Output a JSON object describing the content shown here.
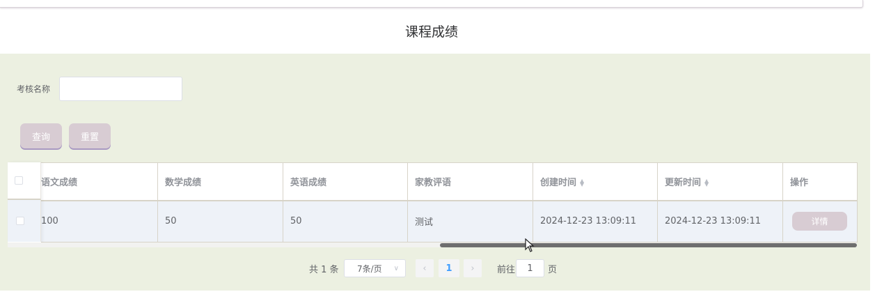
{
  "page": {
    "title": "课程成绩"
  },
  "search": {
    "field_label": "考核名称",
    "field_value": "",
    "field_placeholder": "",
    "query_label": "查询",
    "reset_label": "重置"
  },
  "table": {
    "headers": {
      "chinese": "语文成绩",
      "math": "数学成绩",
      "english": "英语成绩",
      "comment": "家教评语",
      "created": "创建时间",
      "updated": "更新时间",
      "actions": "操作"
    },
    "rows": [
      {
        "chinese": "100",
        "math": "50",
        "english": "50",
        "comment": "测试",
        "created": "2024-12-23 13:09:11",
        "updated": "2024-12-23 13:09:11",
        "action_label": "详情"
      }
    ]
  },
  "pagination": {
    "total_text": "共 1 条",
    "page_size": "7条/页",
    "current_page": "1",
    "goto_label": "前往",
    "goto_value": "1",
    "goto_suffix": "页"
  },
  "icons": {
    "sort": "sort-caret-icon",
    "select_arrow": "chevron-down-icon",
    "prev": "chevron-left-icon",
    "next": "chevron-right-icon"
  },
  "colors": {
    "panel_bg": "#ecf0e1",
    "button_bg": "#d8ccd3",
    "row_bg": "#eef2f8",
    "active_page": "#409eff"
  }
}
